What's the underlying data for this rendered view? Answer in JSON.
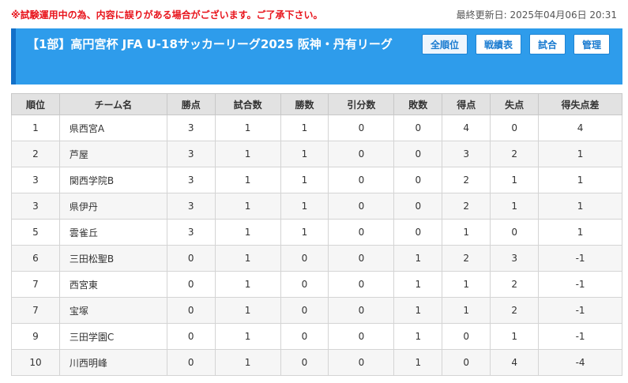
{
  "notice": "※試験運用中の為、内容に誤りがある場合がございます。ご了承下さい。",
  "last_updated": "最終更新日: 2025年04月06日 20:31",
  "league": {
    "title": "【1部】高円宮杯 JFA U-18サッカーリーグ2025 阪神・丹有リーグ"
  },
  "nav": [
    {
      "label": "全順位",
      "active": true
    },
    {
      "label": "戦績表",
      "active": false
    },
    {
      "label": "試合",
      "active": false
    },
    {
      "label": "管理",
      "active": false
    }
  ],
  "colors": {
    "header_bg": "#2e9ceb",
    "header_accent": "#1370c8",
    "notice_red": "#e8141c"
  },
  "table": {
    "columns": [
      "順位",
      "チーム名",
      "勝点",
      "試合数",
      "勝数",
      "引分数",
      "敗数",
      "得点",
      "失点",
      "得失点差"
    ],
    "rows": [
      [
        "1",
        "県西宮A",
        "3",
        "1",
        "1",
        "0",
        "0",
        "4",
        "0",
        "4"
      ],
      [
        "2",
        "芦屋",
        "3",
        "1",
        "1",
        "0",
        "0",
        "3",
        "2",
        "1"
      ],
      [
        "3",
        "関西学院B",
        "3",
        "1",
        "1",
        "0",
        "0",
        "2",
        "1",
        "1"
      ],
      [
        "3",
        "県伊丹",
        "3",
        "1",
        "1",
        "0",
        "0",
        "2",
        "1",
        "1"
      ],
      [
        "5",
        "雲雀丘",
        "3",
        "1",
        "1",
        "0",
        "0",
        "1",
        "0",
        "1"
      ],
      [
        "6",
        "三田松聖B",
        "0",
        "1",
        "0",
        "0",
        "1",
        "2",
        "3",
        "-1"
      ],
      [
        "7",
        "西宮東",
        "0",
        "1",
        "0",
        "0",
        "1",
        "1",
        "2",
        "-1"
      ],
      [
        "7",
        "宝塚",
        "0",
        "1",
        "0",
        "0",
        "1",
        "1",
        "2",
        "-1"
      ],
      [
        "9",
        "三田学園C",
        "0",
        "1",
        "0",
        "0",
        "1",
        "0",
        "1",
        "-1"
      ],
      [
        "10",
        "川西明峰",
        "0",
        "1",
        "0",
        "0",
        "1",
        "0",
        "4",
        "-4"
      ]
    ]
  }
}
